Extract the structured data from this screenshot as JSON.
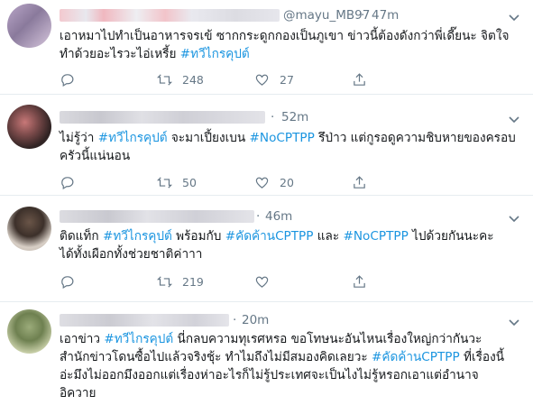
{
  "tweets": [
    {
      "handle": "@mayu_MB97",
      "time": "47m",
      "lines": [
        [
          {
            "t": "เอาหมาไปทำเป็นอาหารจรเข้ ซากกระดูกกองเป็นภูเขา ข่าวนี้ต้องดังกว่าพี่เดี๊ยนะ จิตใจ"
          }
        ],
        [
          {
            "t": "ทำด้วยอะไรวะไอ่เหรี้ย "
          },
          {
            "t": "#ทวีไกรคุปต์",
            "tag": true
          }
        ]
      ],
      "retweets": "248",
      "likes": "27"
    },
    {
      "handle": "",
      "time": "52m",
      "lines": [
        [
          {
            "t": "ไม่รู้ว่า "
          },
          {
            "t": "#ทวีไกรคุปต์",
            "tag": true
          },
          {
            "t": " จะมาเปี้ยงเบน "
          },
          {
            "t": "#NoCPTPP",
            "tag": true
          },
          {
            "t": "  รึป่าว แต่กูรอดูความชิบหายของครอบ"
          }
        ],
        [
          {
            "t": "ครัวนี้แน่นอน"
          }
        ]
      ],
      "retweets": "50",
      "likes": "20"
    },
    {
      "handle": "",
      "time": "46m",
      "lines": [
        [
          {
            "t": "ติดแท็ก "
          },
          {
            "t": "#ทวีไกรคุปต์",
            "tag": true
          },
          {
            "t": " พร้อมกับ "
          },
          {
            "t": "#คัดค้านCPTPP",
            "tag": true
          },
          {
            "t": " และ "
          },
          {
            "t": "#NoCPTPP",
            "tag": true
          },
          {
            "t": "  ไปด้วยกันนะคะ"
          }
        ],
        [
          {
            "t": "ได้ทั้งเผือกทั้งช่วยชาติค่าาา"
          }
        ]
      ],
      "retweets": "219",
      "likes": ""
    },
    {
      "handle": "",
      "time": "20m",
      "lines": [
        [
          {
            "t": "เอาข่าว "
          },
          {
            "t": "#ทวีไกรคุปต์",
            "tag": true
          },
          {
            "t": " นี่กลบความทุเรศหรอ ขอโทษนะอันไหนเรื่องใหญ่กว่ากันวะ"
          }
        ],
        [
          {
            "t": "สำนักข่าวโดนซื้อไปแล้วจริงชุ้ะ ทำไมถึงไม่มีสมองคิดเลยวะ  "
          },
          {
            "t": "#คัดค้านCPTPP",
            "tag": true
          },
          {
            "t": " ที่เรื่องนี้"
          }
        ],
        [
          {
            "t": "อ่ะมึงไม่ออกมึงออกแต่เรื่องห่าอะไรก็ไม่รู้ประเทศจะเป็นไงไม่รู้หรอกเอาแต่อำนาจ"
          }
        ],
        [
          {
            "t": "อิควาย"
          }
        ]
      ],
      "retweets": "",
      "likes": ""
    }
  ],
  "icons": {
    "reply": "reply-icon",
    "retweet": "retweet-icon",
    "like": "heart-icon",
    "share": "share-icon",
    "caret": "chevron-down-icon"
  },
  "colors": {
    "hashtag": "#1b95e0",
    "secondary_text": "#657786",
    "divider": "#e6ecf0"
  }
}
